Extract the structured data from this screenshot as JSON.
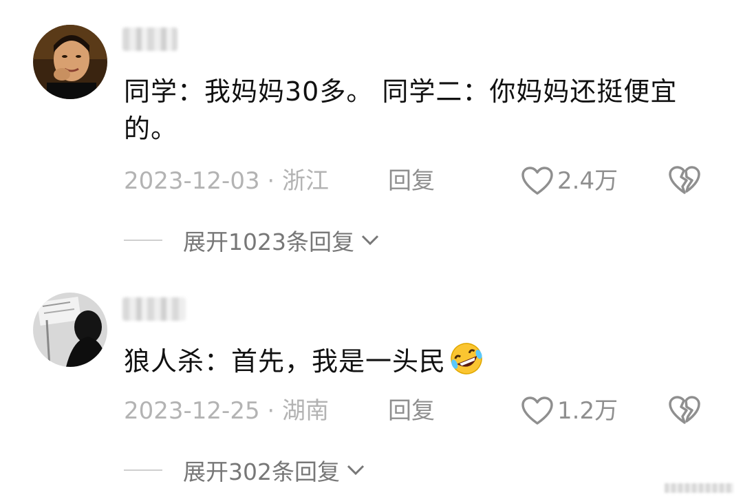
{
  "comments": [
    {
      "text": "同学：我妈妈30多。 同学二：你妈妈还挺便宜的。",
      "date_location": "2023-12-03 · 浙江",
      "reply_label": "回复",
      "likes": "2.4万",
      "expand_label": "展开1023条回复"
    },
    {
      "text": "狼人杀：首先，我是一头民",
      "emoji": "rolling-on-floor-laughing-emoji",
      "date_location": "2023-12-25 · 湖南",
      "reply_label": "回复",
      "likes": "1.2万",
      "expand_label": "展开302条回复"
    }
  ],
  "colors": {
    "text": "#111111",
    "meta": "#b3b3b3",
    "action": "#8f8f8f",
    "expand": "#777777"
  },
  "icons": [
    "heart-icon",
    "broken-heart-icon",
    "chevron-down-icon"
  ]
}
